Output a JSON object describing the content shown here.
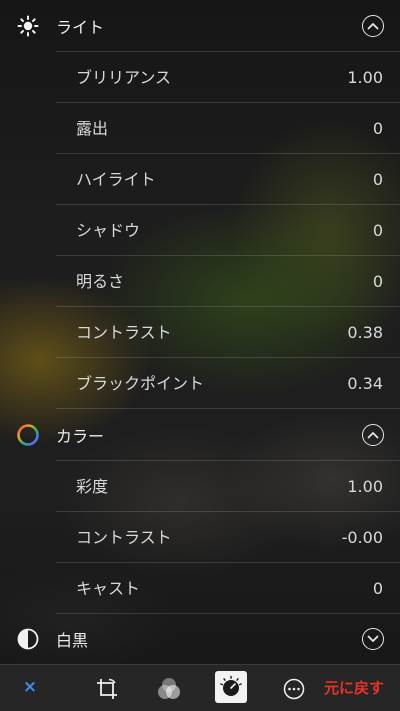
{
  "sections": {
    "light": {
      "title": "ライト",
      "icon": "sun-icon",
      "chevron": "chevron-up-circle-icon",
      "rows": [
        {
          "label": "ブリリアンス",
          "value": "1.00"
        },
        {
          "label": "露出",
          "value": "0"
        },
        {
          "label": "ハイライト",
          "value": "0"
        },
        {
          "label": "シャドウ",
          "value": "0"
        },
        {
          "label": "明るさ",
          "value": "0"
        },
        {
          "label": "コントラスト",
          "value": "0.38"
        },
        {
          "label": "ブラックポイント",
          "value": "0.34"
        }
      ]
    },
    "color": {
      "title": "カラー",
      "icon": "color-wheel-icon",
      "chevron": "chevron-up-circle-icon",
      "rows": [
        {
          "label": "彩度",
          "value": "1.00"
        },
        {
          "label": "コントラスト",
          "value": "-0.00"
        },
        {
          "label": "キャスト",
          "value": "0"
        }
      ]
    },
    "bw": {
      "title": "白黒",
      "icon": "half-circle-icon",
      "chevron": "chevron-down-circle-icon"
    }
  },
  "toolbar": {
    "cancel_glyph": "×",
    "revert_label": "元に戻す",
    "tools": [
      "crop-rotate-icon",
      "filters-icon",
      "adjust-dial-icon",
      "more-icon"
    ],
    "active_tool": "adjust-dial-icon",
    "accent": "#3c8bf0",
    "revert_color": "#e8322c"
  }
}
